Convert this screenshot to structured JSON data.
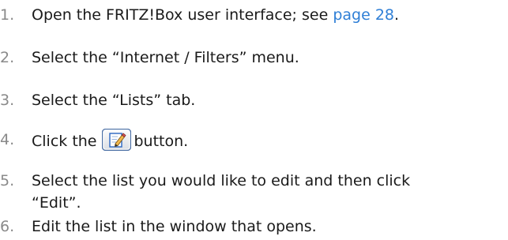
{
  "steps": [
    {
      "number": "1.",
      "text_before": "Open the FRITZ!Box user interface; see ",
      "link_text": "page 28",
      "text_after": "."
    },
    {
      "number": "2.",
      "text": "Select the “Internet / Filters” menu."
    },
    {
      "number": "3.",
      "text": "Select the “Lists” tab."
    },
    {
      "number": "4.",
      "text_before": "Click the",
      "icon": "edit-icon",
      "text_after": "button."
    },
    {
      "number": "5.",
      "line1": "Select the list you would like to edit and then click",
      "line2": "“Edit”."
    },
    {
      "number": "6.",
      "text": "Edit the list in the window that opens."
    }
  ],
  "colors": {
    "text": "#1a1a1a",
    "number": "#8a8a8a",
    "link": "#2f7fd6"
  }
}
